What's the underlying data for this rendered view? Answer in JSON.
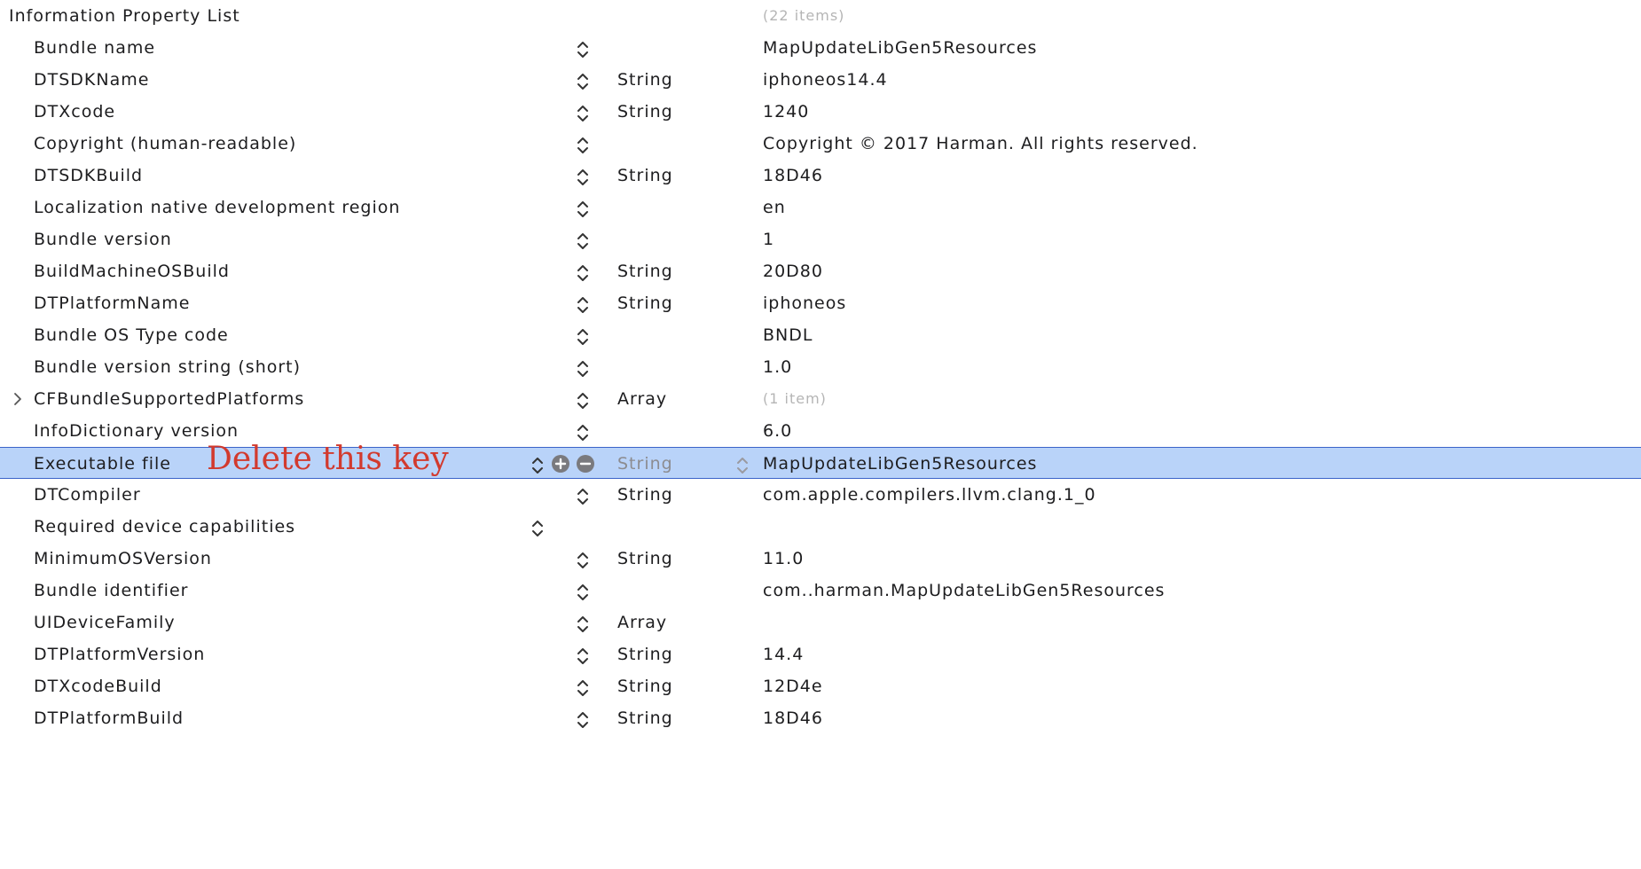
{
  "plist": {
    "root": {
      "key": "Information Property List",
      "value": "(22 items)"
    },
    "rows": [
      {
        "key": "Bundle name",
        "type": "",
        "value": "MapUpdateLibGen5Resources"
      },
      {
        "key": "DTSDKName",
        "type": "String",
        "value": "iphoneos14.4"
      },
      {
        "key": "DTXcode",
        "type": "String",
        "value": "1240"
      },
      {
        "key": "Copyright (human-readable)",
        "type": "",
        "value": "Copyright © 2017 Harman. All rights reserved."
      },
      {
        "key": "DTSDKBuild",
        "type": "String",
        "value": "18D46"
      },
      {
        "key": "Localization native development region",
        "type": "",
        "value": "en"
      },
      {
        "key": "Bundle version",
        "type": "",
        "value": "1"
      },
      {
        "key": "BuildMachineOSBuild",
        "type": "String",
        "value": "20D80"
      },
      {
        "key": "DTPlatformName",
        "type": "String",
        "value": "iphoneos"
      },
      {
        "key": "Bundle OS Type code",
        "type": "",
        "value": "BNDL"
      },
      {
        "key": "Bundle version string (short)",
        "type": "",
        "value": "1.0"
      },
      {
        "key": "CFBundleSupportedPlatforms",
        "type": "Array",
        "value": "(1 item)",
        "collapsed": true
      },
      {
        "key": "InfoDictionary version",
        "type": "",
        "value": "6.0"
      },
      {
        "key": "Executable file",
        "type": "String",
        "value": "MapUpdateLibGen5Resources",
        "selected": true
      },
      {
        "key": "DTCompiler",
        "type": "String",
        "value": "com.apple.compilers.llvm.clang.1_0"
      },
      {
        "key": "Required device capabilities",
        "type": "",
        "value": ""
      },
      {
        "key": "MinimumOSVersion",
        "type": "String",
        "value": "11.0"
      },
      {
        "key": "Bundle identifier",
        "type": "",
        "value": "com..harman.MapUpdateLibGen5Resources"
      },
      {
        "key": "UIDeviceFamily",
        "type": "Array",
        "value": ""
      },
      {
        "key": "DTPlatformVersion",
        "type": "String",
        "value": "14.4"
      },
      {
        "key": "DTXcodeBuild",
        "type": "String",
        "value": "12D4e"
      },
      {
        "key": "DTPlatformBuild",
        "type": "String",
        "value": "18D46"
      }
    ]
  },
  "annotation": {
    "text": "Delete this key",
    "color": "#d23a2e"
  },
  "colors": {
    "selection": "#b9d3f9",
    "selection_border": "#3b63c9",
    "control_gray": "#7a7a7e"
  },
  "icons": {
    "stepper": "up-down-chevron-icon",
    "disclosure": "chevron-right-icon",
    "add": "plus-circle-icon",
    "remove": "minus-circle-icon"
  }
}
